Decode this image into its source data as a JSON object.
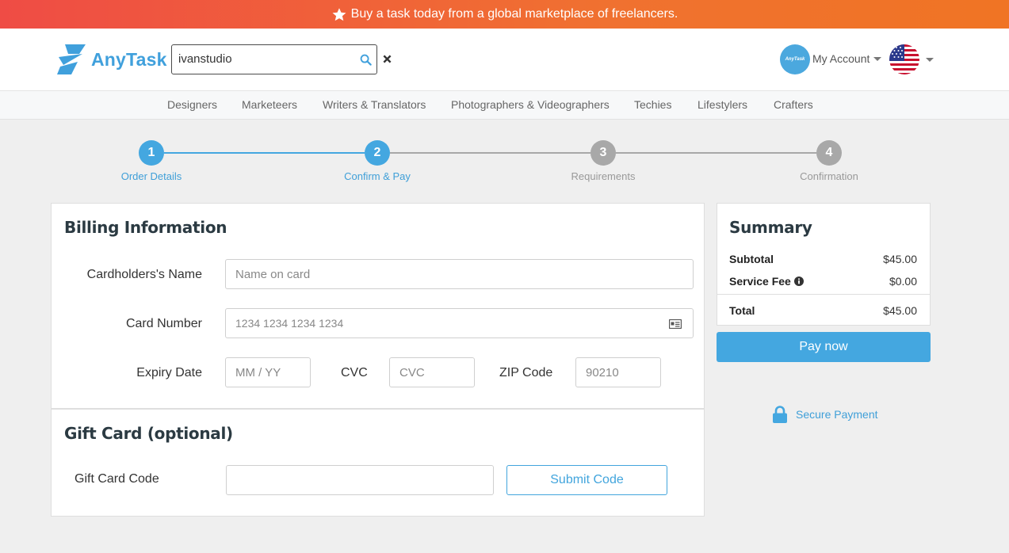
{
  "promo": {
    "text": "Buy a task today from a global marketplace of freelancers."
  },
  "header": {
    "logo_text": "AnyTask",
    "search_value": "ivanstudio",
    "avatar_text": "AnyTask",
    "account_label": "My Account"
  },
  "categories": [
    "Designers",
    "Marketeers",
    "Writers & Translators",
    "Photographers & Videographers",
    "Techies",
    "Lifestylers",
    "Crafters"
  ],
  "steps": [
    {
      "number": "1",
      "label": "Order Details",
      "state": "done"
    },
    {
      "number": "2",
      "label": "Confirm & Pay",
      "state": "active"
    },
    {
      "number": "3",
      "label": "Requirements",
      "state": "pending"
    },
    {
      "number": "4",
      "label": "Confirmation",
      "state": "pending"
    }
  ],
  "billing": {
    "title": "Billing Information",
    "name_label": "Cardholders's Name",
    "name_placeholder": "Name on card",
    "card_label": "Card Number",
    "card_placeholder": "1234 1234 1234 1234",
    "expiry_label": "Expiry Date",
    "expiry_placeholder": "MM / YY",
    "cvc_label": "CVC",
    "cvc_placeholder": "CVC",
    "zip_label": "ZIP Code",
    "zip_placeholder": "90210"
  },
  "gift": {
    "title": "Gift Card (optional)",
    "code_label": "Gift Card Code",
    "code_value": "",
    "submit_label": "Submit Code"
  },
  "summary": {
    "title": "Summary",
    "subtotal_label": "Subtotal",
    "subtotal_value": "$45.00",
    "fee_label": "Service Fee",
    "fee_value": "$0.00",
    "total_label": "Total",
    "total_value": "$45.00",
    "pay_label": "Pay now",
    "secure_label": "Secure Payment"
  },
  "colors": {
    "accent": "#44a7e0",
    "banner_start": "#ef4c45",
    "banner_end": "#f07424",
    "step_pending": "#a8a8a8"
  }
}
